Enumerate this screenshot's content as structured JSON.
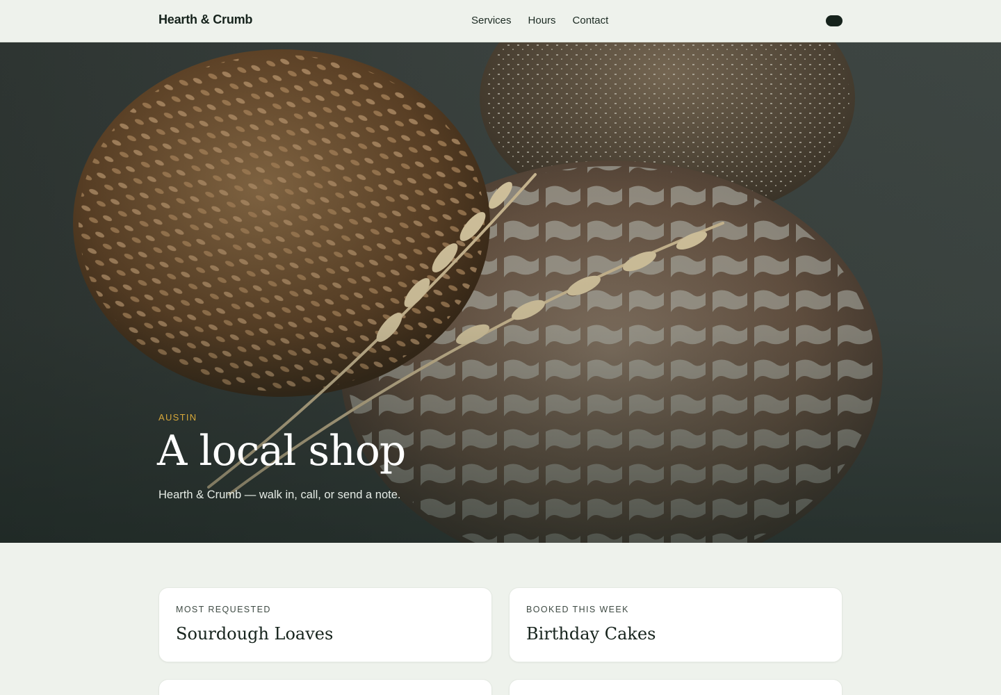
{
  "header": {
    "brand": "Hearth & Crumb",
    "nav": [
      "Services",
      "Hours",
      "Contact"
    ],
    "menu_icon": "menu-pill-icon"
  },
  "hero": {
    "eyebrow": "AUSTIN",
    "title": "A local shop",
    "subtitle": "Hearth & Crumb — walk in, call, or send a note."
  },
  "cards": [
    {
      "kicker": "MOST REQUESTED",
      "title": "Sourdough Loaves"
    },
    {
      "kicker": "BOOKED THIS WEEK",
      "title": "Birthday Cakes"
    }
  ],
  "colors": {
    "page_bg": "#eef2ec",
    "brand_dark": "#16231c",
    "accent_gold": "#d7a83a",
    "card_bg": "#ffffff"
  }
}
